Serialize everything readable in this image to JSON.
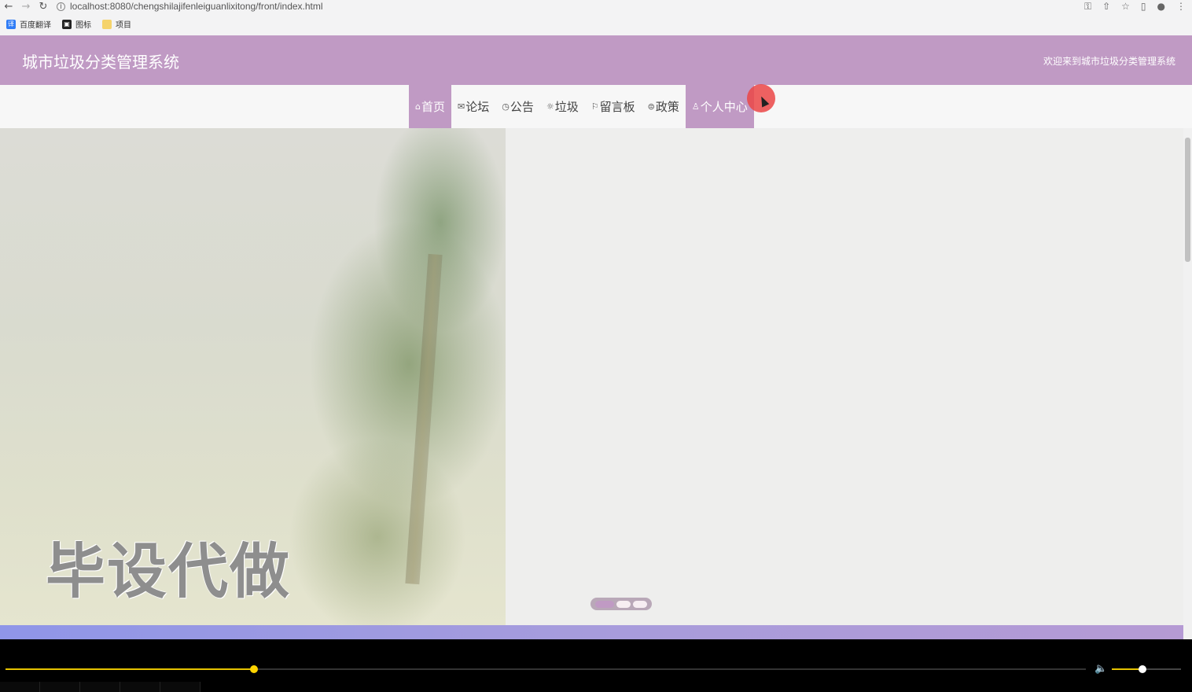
{
  "browser": {
    "url": "localhost:8080/chengshilajifenleiguanlixitong/front/index.html",
    "bookmarks": [
      {
        "label": "百度翻译",
        "icon": "translate-icon"
      },
      {
        "label": "图标",
        "icon": "image-icon"
      },
      {
        "label": "项目",
        "icon": "folder-icon"
      }
    ]
  },
  "header": {
    "title": "城市垃圾分类管理系统",
    "welcome": "欢迎来到城市垃圾分类管理系统"
  },
  "menu": {
    "items": [
      {
        "label": "首页",
        "icon": "home-icon",
        "active": true
      },
      {
        "label": "论坛",
        "icon": "mail-icon",
        "active": false
      },
      {
        "label": "公告",
        "icon": "clock-icon",
        "active": false
      },
      {
        "label": "垃圾",
        "icon": "gear-icon",
        "active": false
      },
      {
        "label": "留言板",
        "icon": "flag-icon",
        "active": false
      },
      {
        "label": "政策",
        "icon": "globe-icon",
        "active": false
      },
      {
        "label": "个人中心",
        "icon": "user-icon",
        "active": true
      }
    ]
  },
  "carousel": {
    "watermark": "毕设代做",
    "slide_count": 3,
    "active_slide": 1
  },
  "player": {
    "progress": 0.23,
    "volume": 0.44
  },
  "colors": {
    "brand": "#c09ac4",
    "accent": "#ffd400"
  }
}
